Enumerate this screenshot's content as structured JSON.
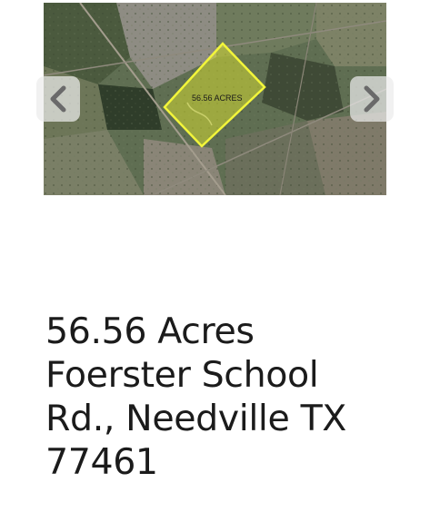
{
  "carousel": {
    "image_label": "56.56 ACRES",
    "prev_icon": "chevron-left-icon",
    "next_icon": "chevron-right-icon",
    "highlight_color": "#e8f02a"
  },
  "listing": {
    "title_lines": [
      "56.56 Acres",
      "Foerster School",
      "Rd., Needville TX",
      "77461"
    ]
  }
}
